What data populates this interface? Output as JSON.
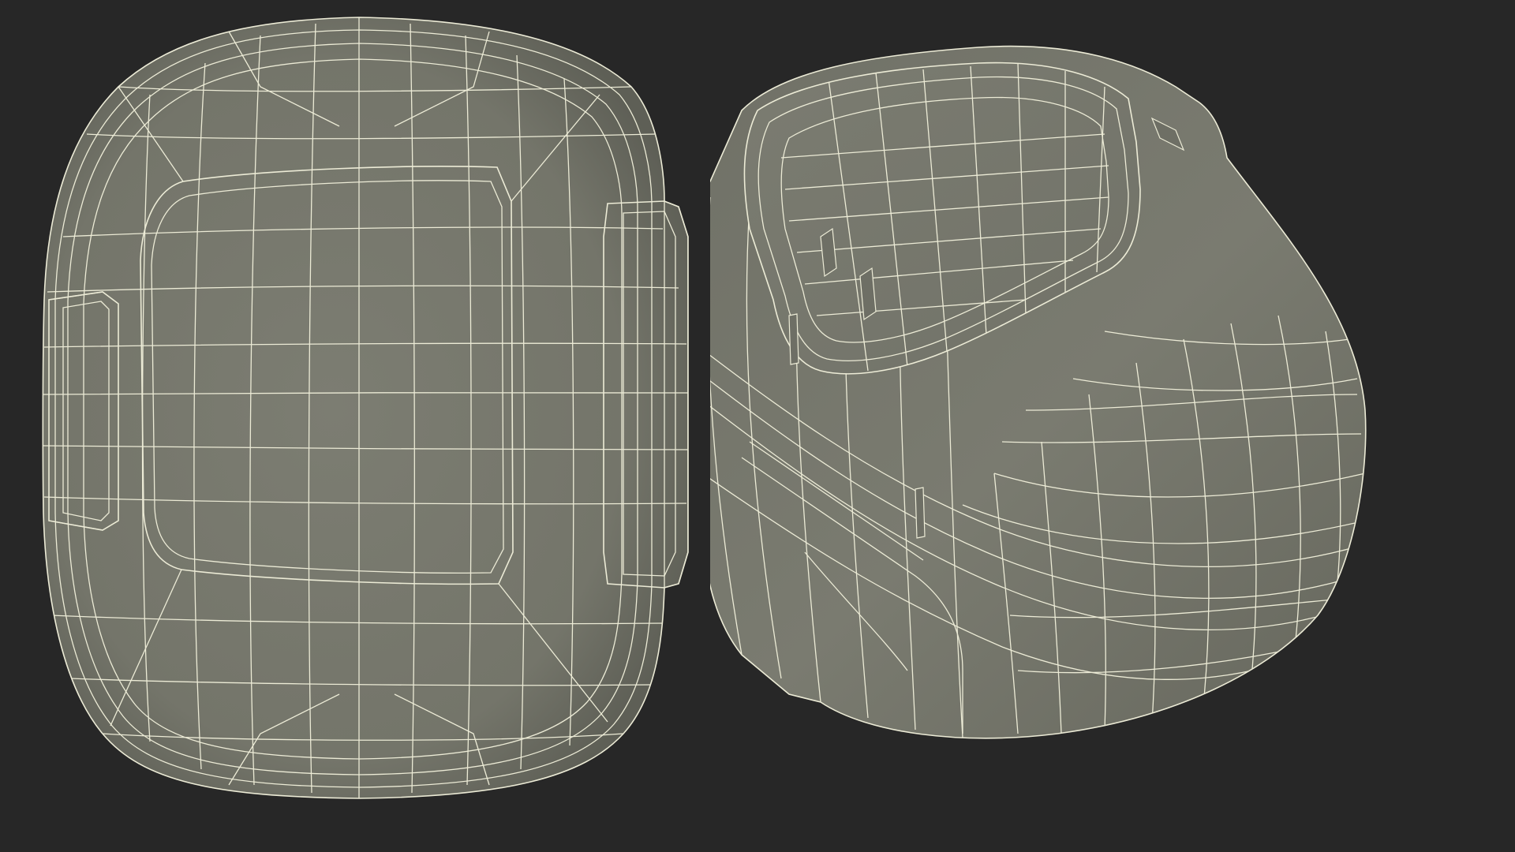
{
  "scene": {
    "background_color": "#272727",
    "surface_color": "#77786d",
    "surface_shadow_color": "#5c5d54",
    "surface_highlight_color": "#8a8b80",
    "wire_color": "#ecebd6",
    "views": [
      {
        "name": "top-view",
        "icon": "wireframe-mesh"
      },
      {
        "name": "perspective-view",
        "icon": "wireframe-mesh"
      }
    ]
  }
}
